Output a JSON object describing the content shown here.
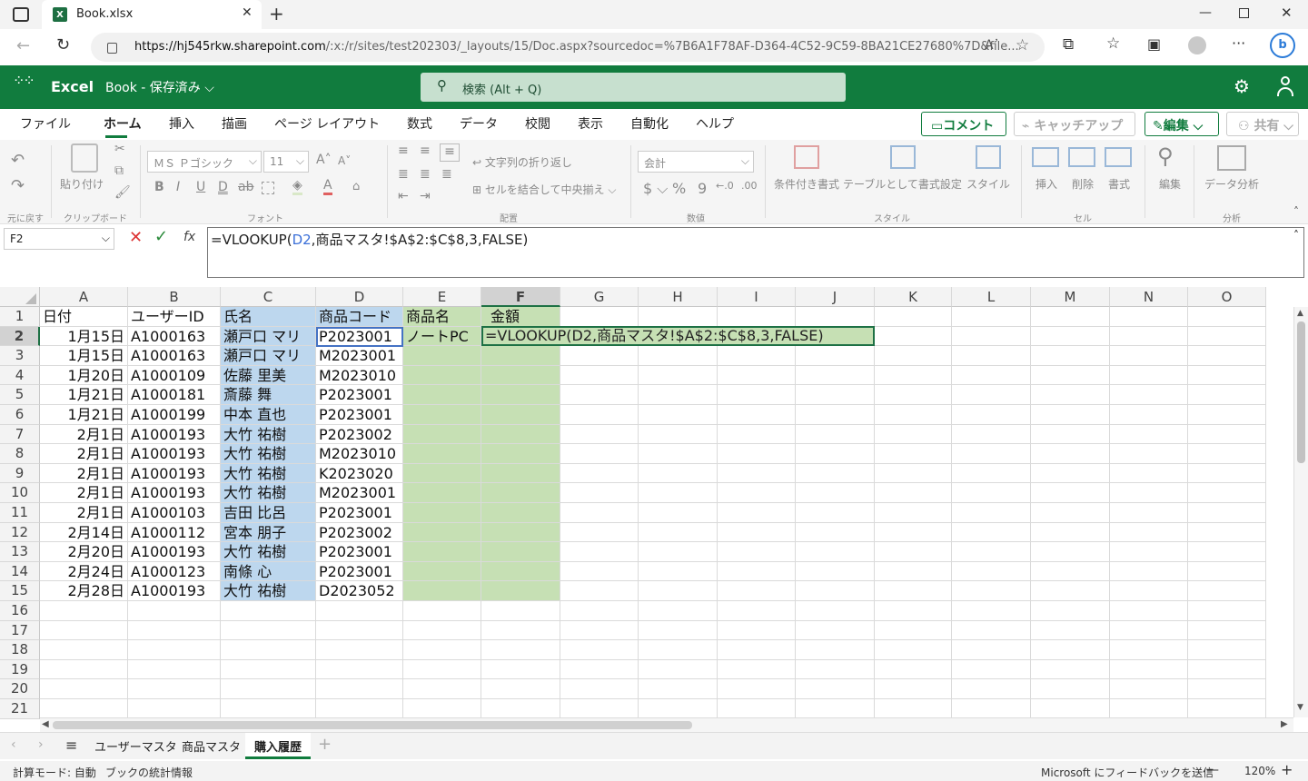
{
  "browser": {
    "tab_title": "Book.xlsx",
    "url_host": "https://hj545rkw.sharepoint.com",
    "url_path": "/:x:/r/sites/test202303/_layouts/15/Doc.aspx?sourcedoc=%7B6A1F78AF-D364-4C52-9C59-8BA21CE27680%7D&file..."
  },
  "app": {
    "name": "Excel",
    "doc_title": "Book - 保存済み",
    "search_placeholder": "検索 (Alt + Q)"
  },
  "menu": [
    "ファイル",
    "ホーム",
    "挿入",
    "描画",
    "ページ レイアウト",
    "数式",
    "データ",
    "校閲",
    "表示",
    "自動化",
    "ヘルプ"
  ],
  "menu_active": "ホーム",
  "actions": {
    "comment": "コメント",
    "catchup": "キャッチアップ",
    "edit": "編集",
    "share": "共有"
  },
  "ribbon": {
    "paste": "貼り付け",
    "font_name": "ＭＳ Ｐゴシック",
    "font_size": "11",
    "wrap_text": "文字列の折り返し",
    "merge_center": "セルを結合して中央揃え",
    "number_format": "会計",
    "cond_format": "条件付き書式",
    "table_format": "テーブルとして書式設定",
    "styles": "スタイル",
    "insert": "挿入",
    "delete": "削除",
    "format": "書式",
    "editing": "編集",
    "data_analysis": "データ分析",
    "groups": {
      "undo": "元に戻す",
      "clipboard": "クリップボード",
      "font": "フォント",
      "align": "配置",
      "number": "数値",
      "style": "スタイル",
      "cells": "セル",
      "analysis": "分析"
    }
  },
  "formula_bar": {
    "name_box": "F2",
    "formula_prefix": "=VLOOKUP(",
    "formula_ref": "D2",
    "formula_suffix": ",商品マスタ!$A$2:$C$8,3,FALSE)"
  },
  "columns": [
    "A",
    "B",
    "C",
    "D",
    "E",
    "F",
    "G",
    "H",
    "I",
    "J",
    "K",
    "L",
    "M",
    "N",
    "O"
  ],
  "rows": [
    "1",
    "2",
    "3",
    "4",
    "5",
    "6",
    "7",
    "8",
    "9",
    "10",
    "11",
    "12",
    "13",
    "14",
    "15",
    "16",
    "17",
    "18",
    "19",
    "20",
    "21"
  ],
  "headers": {
    "A": "日付",
    "B": "ユーザーID",
    "C": "氏名",
    "D": "商品コード",
    "E": "商品名",
    "F": "金額"
  },
  "data": [
    [
      "1月15日",
      "A1000163",
      "瀬戸口 マリ",
      "P2023001",
      "ノートPC"
    ],
    [
      "1月15日",
      "A1000163",
      "瀬戸口 マリ",
      "M2023001",
      ""
    ],
    [
      "1月20日",
      "A1000109",
      "佐藤 里美",
      "M2023010",
      ""
    ],
    [
      "1月21日",
      "A1000181",
      "斎藤 舞",
      "P2023001",
      ""
    ],
    [
      "1月21日",
      "A1000199",
      "中本 直也",
      "P2023001",
      ""
    ],
    [
      "2月1日",
      "A1000193",
      "大竹 祐樹",
      "P2023002",
      ""
    ],
    [
      "2月1日",
      "A1000193",
      "大竹 祐樹",
      "M2023010",
      ""
    ],
    [
      "2月1日",
      "A1000193",
      "大竹 祐樹",
      "K2023020",
      ""
    ],
    [
      "2月1日",
      "A1000193",
      "大竹 祐樹",
      "M2023001",
      ""
    ],
    [
      "2月1日",
      "A1000103",
      "吉田 比呂",
      "P2023001",
      ""
    ],
    [
      "2月14日",
      "A1000112",
      "宮本 朋子",
      "P2023002",
      ""
    ],
    [
      "2月20日",
      "A1000193",
      "大竹 祐樹",
      "P2023001",
      ""
    ],
    [
      "2月24日",
      "A1000123",
      "南條 心",
      "P2023001",
      ""
    ],
    [
      "2月28日",
      "A1000193",
      "大竹 祐樹",
      "D2023052",
      ""
    ]
  ],
  "editing_cell_text": "=VLOOKUP(D2,商品マスタ!$A$2:$C$8,3,FALSE)",
  "sheets": [
    "ユーザーマスタ",
    "商品マスタ",
    "購入履歴"
  ],
  "active_sheet": "購入履歴",
  "status": {
    "calc_mode": "計算モード: 自動",
    "workbook_stats": "ブックの統計情報",
    "feedback": "Microsoft にフィードバックを送信",
    "zoom": "120%"
  },
  "colors": {
    "excel_green": "#117c3e",
    "blue_fill": "#bdd7ee",
    "green_fill": "#c6e0b4"
  }
}
